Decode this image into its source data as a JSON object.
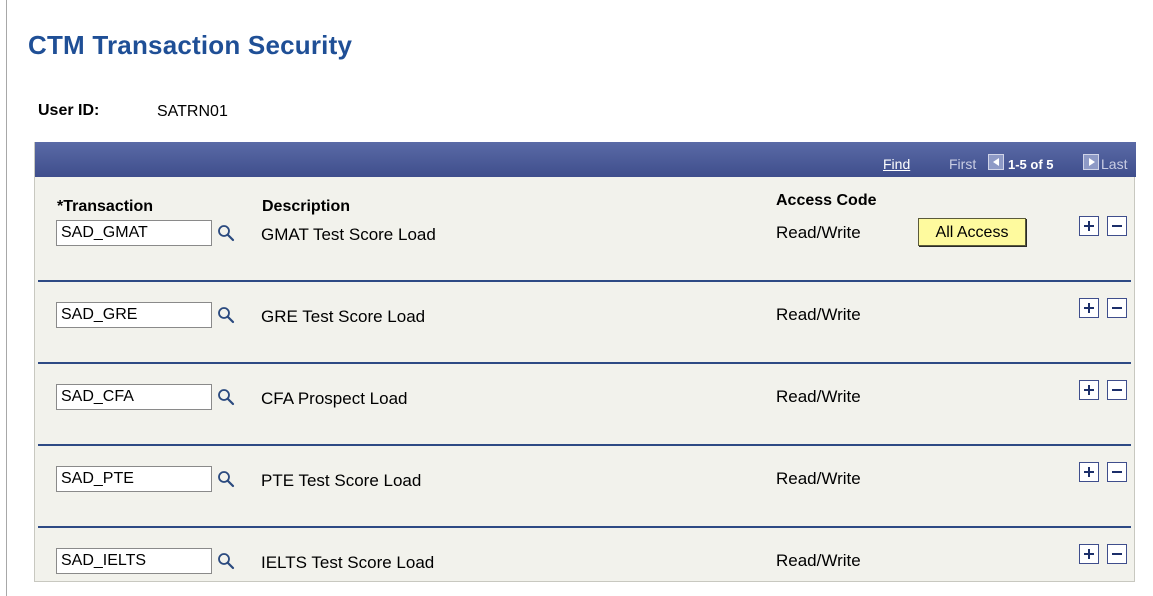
{
  "page": {
    "title": "CTM Transaction Security"
  },
  "user": {
    "label": "User ID:",
    "value": "SATRN01"
  },
  "grid": {
    "nav": {
      "find": "Find",
      "first": "First",
      "count": "1-5 of 5",
      "last": "Last"
    },
    "headers": {
      "transaction": "*Transaction",
      "description": "Description",
      "access_code": "Access Code"
    },
    "all_access_label": "All Access",
    "rows": [
      {
        "transaction": "SAD_GMAT",
        "description": "GMAT Test Score Load",
        "access": "Read/Write"
      },
      {
        "transaction": "SAD_GRE",
        "description": "GRE Test Score Load",
        "access": "Read/Write"
      },
      {
        "transaction": "SAD_CFA",
        "description": "CFA Prospect Load",
        "access": "Read/Write"
      },
      {
        "transaction": "SAD_PTE",
        "description": "PTE Test Score Load",
        "access": "Read/Write"
      },
      {
        "transaction": "SAD_IELTS",
        "description": "IELTS Test Score Load",
        "access": "Read/Write"
      }
    ]
  },
  "icons": {
    "lookup": "magnifier-icon",
    "add": "plus-icon",
    "delete": "minus-icon"
  },
  "colors": {
    "title": "#1f4f96",
    "grid_header": "#3f4e8c",
    "all_access_button": "#fefa9e"
  }
}
